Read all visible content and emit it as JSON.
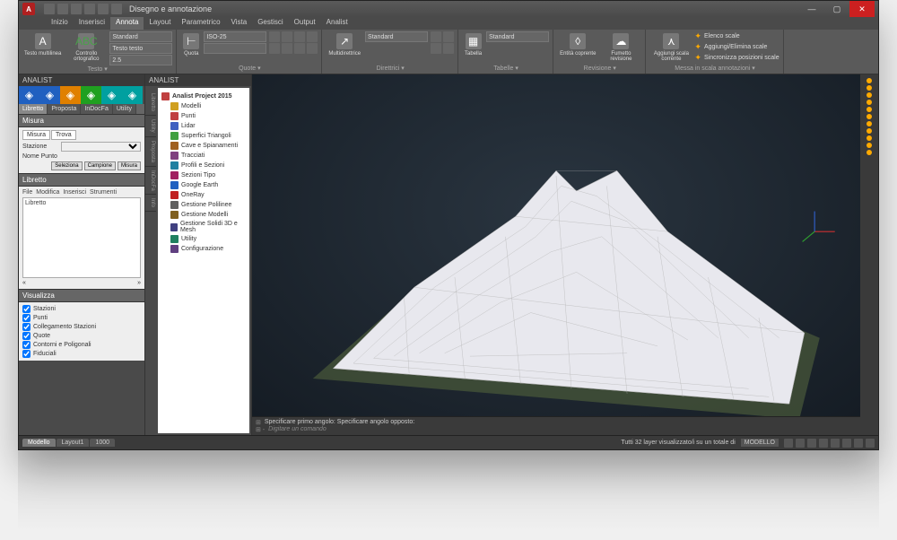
{
  "titlebar": {
    "app_icon_text": "A",
    "title": "Disegno e annotazione",
    "min": "—",
    "max": "▢",
    "close": "✕"
  },
  "menu": {
    "items": [
      "Inizio",
      "Inserisci",
      "Annota",
      "Layout",
      "Parametrico",
      "Vista",
      "Gestisci",
      "Output",
      "Analist"
    ],
    "active": 2
  },
  "ribbon": {
    "groups": [
      {
        "label": "Testo",
        "big": [
          {
            "icon": "A",
            "label": "Testo multilinea",
            "name": "text-multiline-button"
          },
          {
            "icon": "ABC",
            "label": "Controllo ortografico",
            "name": "spell-check-button",
            "color": "#4aa04a"
          }
        ],
        "dropdowns": [
          "Standard",
          "Testo testo",
          "2.5"
        ]
      },
      {
        "label": "Quote",
        "big": [
          {
            "icon": "⊢",
            "label": "Quota",
            "name": "quota-button"
          }
        ],
        "dropdowns": [
          "ISO-25",
          ""
        ],
        "icons": 8
      },
      {
        "label": "Direttrici",
        "big": [
          {
            "icon": "↗",
            "label": "Multidirettrice",
            "name": "multileader-button"
          }
        ],
        "dropdowns": [
          "Standard"
        ],
        "icons": 4
      },
      {
        "label": "Tabelle",
        "big": [
          {
            "icon": "▦",
            "label": "Tabella",
            "name": "table-button"
          }
        ],
        "dropdowns": [
          "Standard"
        ]
      },
      {
        "label": "Revisione",
        "big": [
          {
            "icon": "◊",
            "label": "Entità coprente",
            "name": "wipeout-button"
          },
          {
            "icon": "☁",
            "label": "Fumetto revisione",
            "name": "revision-cloud-button"
          }
        ]
      },
      {
        "label": "Messa in scala annotazioni",
        "big": [
          {
            "icon": "⋏",
            "label": "Aggiungi scala corrente",
            "name": "add-scale-button"
          }
        ],
        "links": [
          "Elenco scale",
          "Aggiungi/Elimina scale",
          "Sincronizza posizioni scale"
        ]
      }
    ]
  },
  "left_panel": {
    "title": "ANALIST",
    "tool_colors": [
      "#2060c0",
      "#2060c0",
      "#e08000",
      "#20a020",
      "#00a0a0",
      "#00a0a0"
    ],
    "subtabs": [
      "Libretto",
      "Proposta",
      "InDocFa",
      "Utility"
    ],
    "misura": {
      "title": "Misura",
      "tabs": [
        "Misura",
        "Trova"
      ],
      "stazione_label": "Stazione",
      "nome_punto_label": "Nome Punto",
      "buttons": [
        "Seleziona",
        "Campione",
        "Misura"
      ]
    },
    "libretto": {
      "title": "Libretto",
      "menu": [
        "File",
        "Modifica",
        "Inserisci",
        "Strumenti"
      ],
      "content": "Libretto",
      "scroll_left": "«",
      "scroll_right": "»"
    },
    "visualizza": {
      "title": "Visualizza",
      "items": [
        "Stazioni",
        "Punti",
        "Collegamento Stazioni",
        "Quote",
        "Contorni e Poligonali",
        "Fiduciali"
      ]
    }
  },
  "middle_panel": {
    "title": "ANALIST",
    "tree_root": "Analist Project 2015",
    "tree_items": [
      {
        "label": "Modelli",
        "color": "#d0a020"
      },
      {
        "label": "Punti",
        "color": "#c04040"
      },
      {
        "label": "Lidar",
        "color": "#4060c0"
      },
      {
        "label": "Superfici Triangoli",
        "color": "#40a040"
      },
      {
        "label": "Cave e Spianamenti",
        "color": "#a06020"
      },
      {
        "label": "Tracciati",
        "color": "#804080"
      },
      {
        "label": "Profili e Sezioni",
        "color": "#2080a0"
      },
      {
        "label": "Sezioni Tipo",
        "color": "#a02060"
      },
      {
        "label": "Google Earth",
        "color": "#2060c0"
      },
      {
        "label": "OneRay",
        "color": "#c02020"
      },
      {
        "label": "Gestione Polilinee",
        "color": "#606060"
      },
      {
        "label": "Gestione Modelli",
        "color": "#806020"
      },
      {
        "label": "Gestione Solidi 3D e Mesh",
        "color": "#404080"
      },
      {
        "label": "Utility",
        "color": "#208060"
      },
      {
        "label": "Configurazione",
        "color": "#604080"
      }
    ],
    "side_tabs": [
      "Libretto",
      "Utility",
      "Proposta",
      "InDocFa",
      "Info"
    ]
  },
  "cmdline": {
    "line1_prefix": "⊞",
    "line1": "Specificare primo angolo: Specificare angolo opposto:",
    "line2_prefix": "⊞ -",
    "line2_placeholder": "Digitare un comando"
  },
  "statusbar": {
    "tabs": [
      "Modello",
      "Layout1",
      "1000"
    ],
    "layer_info": "Tutti 32 layer visualizzato/i su un totale di",
    "modello": "MODELLO"
  }
}
